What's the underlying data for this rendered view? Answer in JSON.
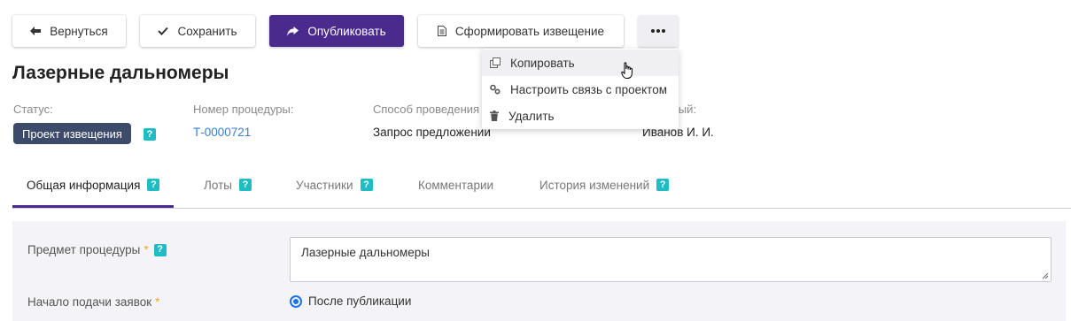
{
  "toolbar": {
    "back_label": "Вернуться",
    "save_label": "Сохранить",
    "publish_label": "Опубликовать",
    "notice_label": "Сформировать извещение",
    "more_icon": "ellipsis-icon"
  },
  "page": {
    "title": "Лазерные дальномеры"
  },
  "meta": {
    "status_label": "Статус:",
    "status_value": "Проект извещения",
    "number_label": "Номер процедуры:",
    "number_value": "Т-0000721",
    "method_label": "Способ проведения",
    "method_value": "Запрос предложений",
    "responsible_label": "ственный:",
    "responsible_value": "Иванов И. И.",
    "help_glyph": "?"
  },
  "tabs": [
    {
      "label": "Общая информация",
      "active": true
    },
    {
      "label": "Лоты"
    },
    {
      "label": "Участники"
    },
    {
      "label": "Комментарии"
    },
    {
      "label": "История изменений"
    }
  ],
  "form": {
    "subject_label": "Предмет процедуры",
    "subject_value": "Лазерные дальномеры",
    "start_label": "Начало подачи заявок",
    "start_option": "После публикации",
    "required_mark": "*"
  },
  "menu": {
    "items": [
      {
        "label": "Копировать",
        "icon": "copy-icon"
      },
      {
        "label": "Настроить связь с проектом",
        "icon": "link-gears-icon"
      },
      {
        "label": "Удалить",
        "icon": "trash-icon"
      }
    ]
  },
  "colors": {
    "primary": "#4a2a8d",
    "status_badge": "#3d4b6b",
    "help_badge": "#1fbcc6",
    "link": "#3b7dd8",
    "required": "#f5a623"
  }
}
